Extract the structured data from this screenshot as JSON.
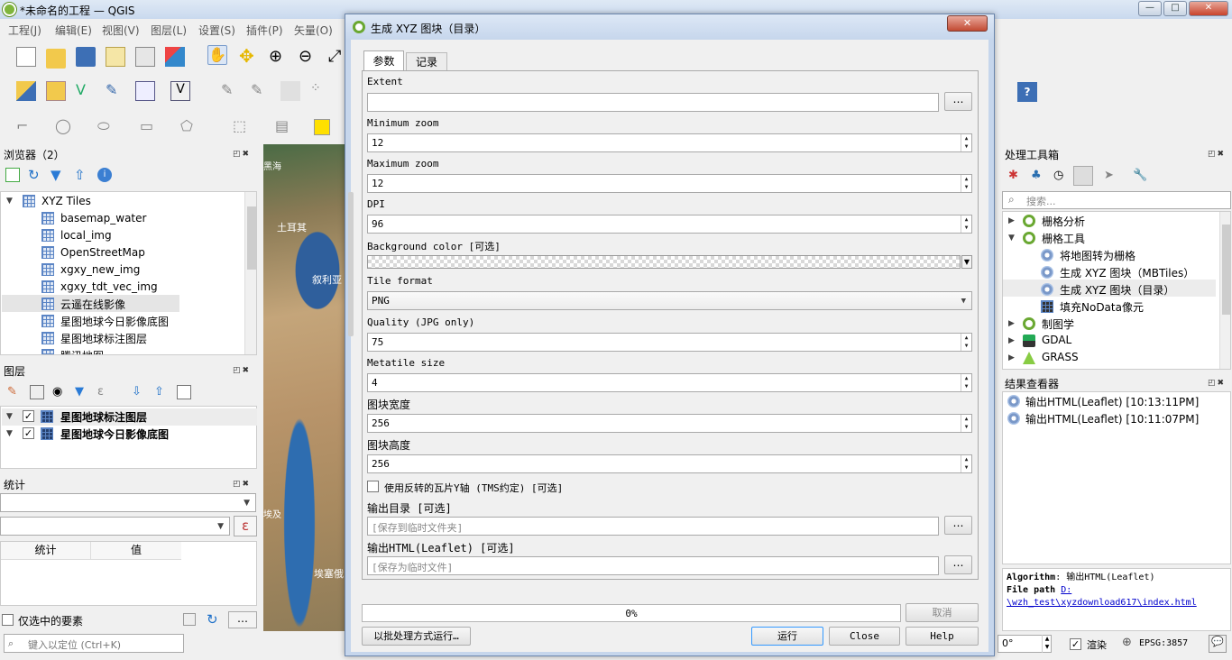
{
  "window": {
    "title": "*未命名的工程 — QGIS",
    "min": "—",
    "max": "□",
    "close": "✕"
  },
  "menu": [
    "工程(J)",
    "编辑(E)",
    "视图(V)",
    "图层(L)",
    "设置(S)",
    "插件(P)",
    "矢量(O)"
  ],
  "browser": {
    "title": "浏览器（2）",
    "root": "XYZ Tiles",
    "items": [
      "basemap_water",
      "local_img",
      "OpenStreetMap",
      "xgxy_new_img",
      "xgxy_tdt_vec_img",
      "云遥在线影像",
      "星图地球今日影像底图",
      "星图地球标注图层",
      "腾讯地图"
    ]
  },
  "layers": {
    "title": "图层",
    "items": [
      "星图地球标注图层",
      "星图地球今日影像底图"
    ]
  },
  "stats": {
    "title": "统计",
    "expression_icon": "ε",
    "col_stat": "统计",
    "col_value": "值",
    "selected_only": "仅选中的要素"
  },
  "locator": {
    "placeholder": "键入以定位 (Ctrl+K)"
  },
  "map": {
    "labels": [
      "黑海",
      "土耳其",
      "叙利亚",
      "埃塞俄",
      "埃及"
    ]
  },
  "dialog": {
    "title": "生成 XYZ 图块（目录）",
    "close": "✕",
    "tabs": [
      "参数",
      "记录"
    ],
    "extent_label": "Extent",
    "extent_value": "",
    "min_zoom_label": "Minimum zoom",
    "min_zoom": "12",
    "max_zoom_label": "Maximum zoom",
    "max_zoom": "12",
    "dpi_label": "DPI",
    "dpi": "96",
    "bg_label": "Background color [可选]",
    "tile_format_label": "Tile format",
    "tile_format": "PNG",
    "quality_label": "Quality (JPG only)",
    "quality": "75",
    "metatile_label": "Metatile size",
    "metatile": "4",
    "tile_width_label": "图块宽度",
    "tile_width": "256",
    "tile_height_label": "图块高度",
    "tile_height": "256",
    "tms_label": "使用反转的瓦片Y轴 (TMS约定) [可选]",
    "outdir_label": "输出目录 [可选]",
    "outdir_placeholder": "[保存到临时文件夹]",
    "outhtml_label": "输出HTML(Leaflet) [可选]",
    "outhtml_placeholder": "[保存为临时文件]",
    "dots": "…",
    "progress": 0,
    "progress_text": "0%",
    "cancel": "取消",
    "batch": "以批处理方式运行…",
    "run": "运行",
    "close_btn": "Close",
    "help": "Help"
  },
  "toolbox": {
    "title": "处理工具箱",
    "search_placeholder": "搜索...",
    "items": [
      {
        "label": "栅格分析",
        "level": 0,
        "icon": "qgis-icon",
        "exp": "▶"
      },
      {
        "label": "栅格工具",
        "level": 0,
        "icon": "qgis-icon",
        "exp": "▼"
      },
      {
        "label": "将地图转为栅格",
        "level": 1,
        "icon": "gear-icon",
        "exp": ""
      },
      {
        "label": "生成 XYZ 图块（MBTiles）",
        "level": 1,
        "icon": "gear-icon",
        "exp": ""
      },
      {
        "label": "生成 XYZ 图块（目录）",
        "level": 1,
        "icon": "gear-icon",
        "exp": ""
      },
      {
        "label": "填充NoData像元",
        "level": 1,
        "icon": "grid-icon",
        "exp": ""
      },
      {
        "label": "制图学",
        "level": 0,
        "icon": "qgis-icon",
        "exp": "▶"
      },
      {
        "label": "GDAL",
        "level": 0,
        "icon": "gdal-icon",
        "exp": "▶"
      },
      {
        "label": "GRASS",
        "level": 0,
        "icon": "grass-icon",
        "exp": "▶"
      }
    ]
  },
  "results": {
    "title": "结果查看器",
    "items": [
      "输出HTML(Leaflet) [10:13:11PM]",
      "输出HTML(Leaflet) [10:11:07PM]"
    ],
    "info_alg_key": "Algorithm",
    "info_alg_val": ": 输出HTML(Leaflet)",
    "info_path_key": "File path",
    "info_path_val1": "D:",
    "info_path_val2": "\\wzh_test\\xyzdownload617\\index.html"
  },
  "statusbar": {
    "rotation": "0°",
    "render": "渲染",
    "epsg": "EPSG:3857"
  },
  "colors": {
    "accent": "#3399ff",
    "qgis_green": "#6aa832"
  }
}
